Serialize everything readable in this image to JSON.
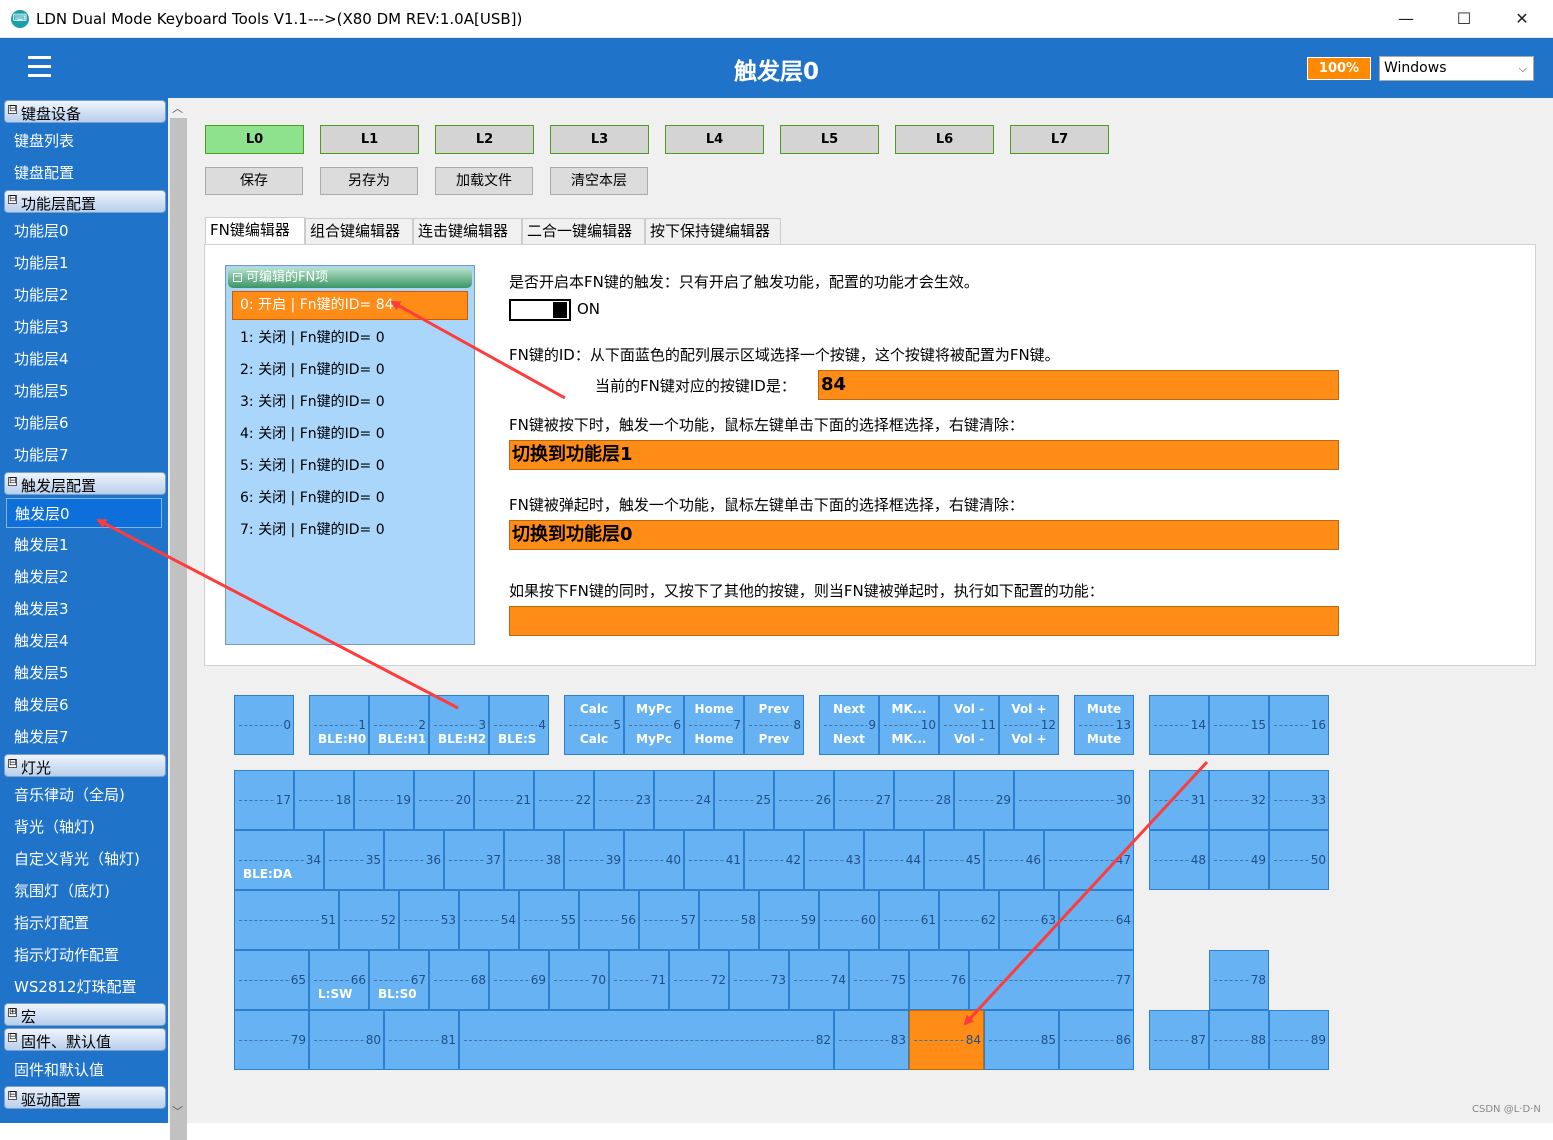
{
  "window": {
    "title": "LDN Dual Mode Keyboard Tools V1.1--->(X80 DM REV:1.0A[USB])",
    "minimize": "—",
    "maximize": "☐",
    "close": "✕",
    "app_icon": "keyboard-logo-icon"
  },
  "header": {
    "title": "触发层0",
    "zoom": "100%",
    "os_select": "Windows",
    "colors": {
      "bar": "#1f73c9",
      "accent": "#ff8a00"
    }
  },
  "sidebar": {
    "groups": [
      {
        "label": "键盘设备",
        "toggle": "⊟",
        "items": [
          "键盘列表",
          "键盘配置"
        ]
      },
      {
        "label": "功能层配置",
        "toggle": "⊟",
        "items": [
          "功能层0",
          "功能层1",
          "功能层2",
          "功能层3",
          "功能层4",
          "功能层5",
          "功能层6",
          "功能层7"
        ]
      },
      {
        "label": "触发层配置",
        "toggle": "⊟",
        "items": [
          "触发层0",
          "触发层1",
          "触发层2",
          "触发层3",
          "触发层4",
          "触发层5",
          "触发层6",
          "触发层7"
        ]
      },
      {
        "label": "灯光",
        "toggle": "⊟",
        "items": [
          "音乐律动（全局)",
          "背光（轴灯)",
          "自定义背光（轴灯)",
          "氛围灯（底灯)",
          "指示灯配置",
          "指示灯动作配置",
          "WS2812灯珠配置"
        ]
      },
      {
        "label": "宏",
        "toggle": "⊞",
        "items": []
      },
      {
        "label": "固件、默认值",
        "toggle": "⊟",
        "items": [
          "固件和默认值"
        ]
      },
      {
        "label": "驱动配置",
        "toggle": "⊟",
        "items": []
      }
    ],
    "selected": "触发层0"
  },
  "layers": [
    "L0",
    "L1",
    "L2",
    "L3",
    "L4",
    "L5",
    "L6",
    "L7"
  ],
  "actions": [
    "保存",
    "另存为",
    "加载文件",
    "清空本层"
  ],
  "tabs": [
    "FN键编辑器",
    "组合键编辑器",
    "连击键编辑器",
    "二合一键编辑器",
    "按下保持键编辑器"
  ],
  "fn_list": {
    "title": "可编辑的FN项",
    "items": [
      "0: 开启 | Fn键的ID= 84",
      "1: 关闭 | Fn键的ID= 0",
      "2: 关闭 | Fn键的ID= 0",
      "3: 关闭 | Fn键的ID= 0",
      "4: 关闭 | Fn键的ID= 0",
      "5: 关闭 | Fn键的ID= 0",
      "6: 关闭 | Fn键的ID= 0",
      "7: 关闭 | Fn键的ID= 0"
    ]
  },
  "config": {
    "enable_label": "是否开启本FN键的触发：只有开启了触发功能，配置的功能才会生效。",
    "toggle_state": "ON",
    "id_label": "FN键的ID：从下面蓝色的配列展示区域选择一个按键，这个按键将被配置为FN键。",
    "current_id_label": "当前的FN键对应的按键ID是：",
    "current_id": "84",
    "press_label": "FN键被按下时，触发一个功能，鼠标左键单击下面的选择框选择，右键清除：",
    "press_value": "切换到功能层1",
    "release_label": "FN键被弹起时，触发一个功能，鼠标左键单击下面的选择框选择，右键清除：",
    "release_value": "切换到功能层0",
    "combo_label": "如果按下FN键的同时，又按下了其他的按键，则当FN键被弹起时，执行如下配置的功能：",
    "combo_value": ""
  },
  "keyboard": {
    "highlight_color": "#ff8c16",
    "key_color": "#66b2f2",
    "keys": [
      {
        "id": "0"
      },
      {
        "id": "1",
        "bl": "BLE:H0"
      },
      {
        "id": "2",
        "bl": "BLE:H1"
      },
      {
        "id": "3",
        "bl": "BLE:H2"
      },
      {
        "id": "4",
        "bl": "BLE:S"
      },
      {
        "id": "5",
        "top": "Calc",
        "bot": "Calc"
      },
      {
        "id": "6",
        "top": "MyPc",
        "bot": "MyPc"
      },
      {
        "id": "7",
        "top": "Home",
        "bot": "Home"
      },
      {
        "id": "8",
        "top": "Prev",
        "bot": "Prev"
      },
      {
        "id": "9",
        "top": "Next",
        "bot": "Next"
      },
      {
        "id": "10",
        "top": "MK...",
        "bot": "MK..."
      },
      {
        "id": "11",
        "top": "Vol -",
        "bot": "Vol -"
      },
      {
        "id": "12",
        "top": "Vol +",
        "bot": "Vol +"
      },
      {
        "id": "13",
        "top": "Mute",
        "bot": "Mute"
      },
      {
        "id": "14"
      },
      {
        "id": "15"
      },
      {
        "id": "16"
      },
      {
        "id": "17"
      },
      {
        "id": "18"
      },
      {
        "id": "19"
      },
      {
        "id": "20"
      },
      {
        "id": "21"
      },
      {
        "id": "22"
      },
      {
        "id": "23"
      },
      {
        "id": "24"
      },
      {
        "id": "25"
      },
      {
        "id": "26"
      },
      {
        "id": "27"
      },
      {
        "id": "28"
      },
      {
        "id": "29"
      },
      {
        "id": "30"
      },
      {
        "id": "31"
      },
      {
        "id": "32"
      },
      {
        "id": "33"
      },
      {
        "id": "34",
        "bl": "BLE:DA"
      },
      {
        "id": "35"
      },
      {
        "id": "36"
      },
      {
        "id": "37"
      },
      {
        "id": "38"
      },
      {
        "id": "39"
      },
      {
        "id": "40"
      },
      {
        "id": "41"
      },
      {
        "id": "42"
      },
      {
        "id": "43"
      },
      {
        "id": "44"
      },
      {
        "id": "45"
      },
      {
        "id": "46"
      },
      {
        "id": "47"
      },
      {
        "id": "48"
      },
      {
        "id": "49"
      },
      {
        "id": "50"
      },
      {
        "id": "51"
      },
      {
        "id": "52"
      },
      {
        "id": "53"
      },
      {
        "id": "54"
      },
      {
        "id": "55"
      },
      {
        "id": "56"
      },
      {
        "id": "57"
      },
      {
        "id": "58"
      },
      {
        "id": "59"
      },
      {
        "id": "60"
      },
      {
        "id": "61"
      },
      {
        "id": "62"
      },
      {
        "id": "63"
      },
      {
        "id": "64"
      },
      {
        "id": "65"
      },
      {
        "id": "66",
        "bl": "L:SW"
      },
      {
        "id": "67",
        "bl": "BL:S0"
      },
      {
        "id": "68"
      },
      {
        "id": "69"
      },
      {
        "id": "70"
      },
      {
        "id": "71"
      },
      {
        "id": "72"
      },
      {
        "id": "73"
      },
      {
        "id": "74"
      },
      {
        "id": "75"
      },
      {
        "id": "76"
      },
      {
        "id": "77"
      },
      {
        "id": "78"
      },
      {
        "id": "79"
      },
      {
        "id": "80"
      },
      {
        "id": "81"
      },
      {
        "id": "82"
      },
      {
        "id": "83"
      },
      {
        "id": "84",
        "highlight": true
      },
      {
        "id": "85"
      },
      {
        "id": "86"
      },
      {
        "id": "87"
      },
      {
        "id": "88"
      },
      {
        "id": "89"
      }
    ]
  },
  "watermark": "CSDN @L·D·N"
}
